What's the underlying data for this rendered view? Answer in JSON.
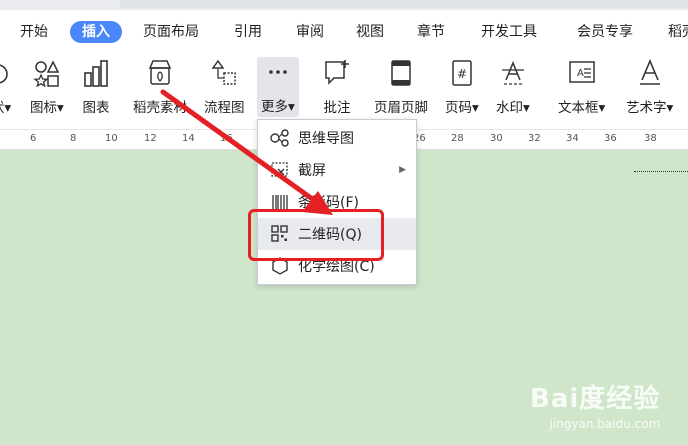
{
  "menubar": {
    "tabs": [
      {
        "label": "开始"
      },
      {
        "label": "插入"
      },
      {
        "label": "页面布局"
      },
      {
        "label": "引用"
      },
      {
        "label": "审阅"
      },
      {
        "label": "视图"
      },
      {
        "label": "章节"
      },
      {
        "label": "开发工具"
      },
      {
        "label": "会员专享"
      },
      {
        "label": "稻壳"
      }
    ],
    "active_tab": "插入",
    "accent_color": "#4a86f7"
  },
  "ribbon": {
    "items": [
      {
        "label": "状▾",
        "icon": "shape-icon"
      },
      {
        "label": "图标▾",
        "icon": "icons-icon"
      },
      {
        "label": "图表",
        "icon": "chart-icon"
      },
      {
        "label": "稻壳素材",
        "icon": "material-icon"
      },
      {
        "label": "流程图",
        "icon": "flowchart-icon"
      },
      {
        "label": "更多▾",
        "icon": "more-icon"
      },
      {
        "label": "批注",
        "icon": "comment-icon"
      },
      {
        "label": "页眉页脚",
        "icon": "header-footer-icon"
      },
      {
        "label": "页码▾",
        "icon": "page-number-icon"
      },
      {
        "label": "水印▾",
        "icon": "watermark-icon"
      },
      {
        "label": "文本框▾",
        "icon": "textbox-icon"
      },
      {
        "label": "艺术字▾",
        "icon": "wordart-icon"
      }
    ]
  },
  "ruler": {
    "ticks": [
      "6",
      "8",
      "10",
      "12",
      "14",
      "16",
      "18",
      "20",
      "22",
      "24",
      "26",
      "28",
      "30",
      "32",
      "34",
      "36",
      "38"
    ]
  },
  "dropdown": {
    "items": [
      {
        "label": "思维导图",
        "icon": "mindmap-icon"
      },
      {
        "label": "截屏",
        "icon": "screenshot-icon",
        "has_submenu": true
      },
      {
        "label": "条形码(F)",
        "icon": "barcode-icon"
      },
      {
        "label": "二维码(Q)",
        "icon": "qrcode-icon",
        "highlighted": true
      },
      {
        "label": "化学绘图(C)",
        "icon": "chemistry-icon"
      }
    ]
  },
  "annotation": {
    "color": "#e42024"
  },
  "watermark": {
    "line1": "Bai度经验",
    "line2": "jingyan.baidu.com"
  }
}
